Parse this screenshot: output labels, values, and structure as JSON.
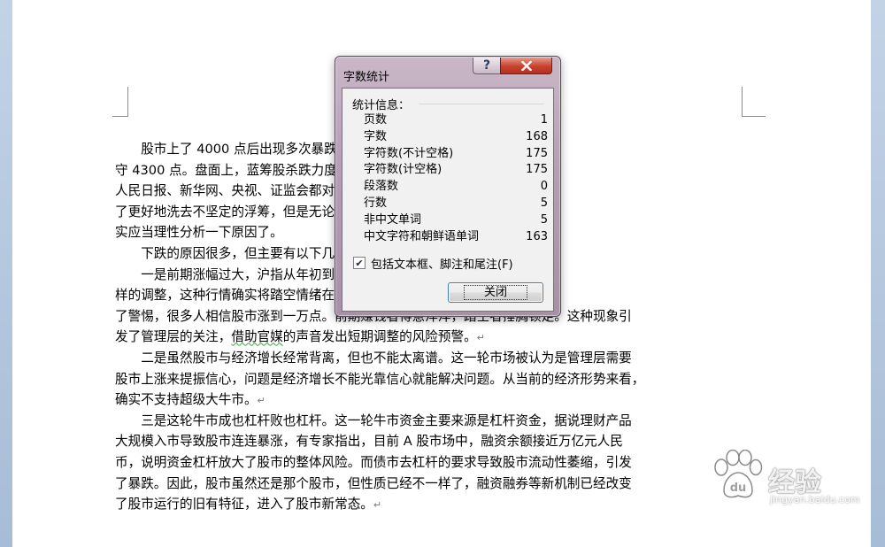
{
  "document": {
    "lines": [
      {
        "indent": true,
        "text": "股市上了 4000 点后出现多次暴跌，据报道称，5 日沪指跌逾 4%，失"
      },
      {
        "indent": false,
        "text": "守 4300 点。盘面上，蓝筹股杀跌力度最大，板块跌幅居前，而就在此前，"
      },
      {
        "indent": false,
        "text": "人民日报、新华网、央视、证监会都对市场暴跌，有的人认为是洗盘，为"
      },
      {
        "indent": false,
        "text": "了更好地洗去不坚定的浮筹，但是无论是洗盘还是见顶，这次大跌确"
      },
      {
        "indent": false,
        "text": "实应当理性分析一下原因了。"
      },
      {
        "indent": true,
        "text": "下跌的原因很多，但主要有以下几点："
      },
      {
        "indent": true,
        "text": "一是前期涨幅过大，沪指从年初到 4500 点左右，几乎没有像"
      },
      {
        "indent": false,
        "text": "样的调整，这种行情确实将踏空情绪在民间传染，人们已经逐渐失去"
      },
      {
        "indent": false,
        "text": "了警惕，很多人相信股市涨到一万点。前期赚钱者得意洋洋，踏空者捶胸顿足。这种现象引"
      },
      {
        "indent": false,
        "pre": "发了管理层的关注，",
        "wavy": "借助官媒",
        "post": "的声音发出短期调整的风险预警。",
        "mark": "↵"
      },
      {
        "indent": true,
        "text": "二是虽然股市与经济增长经常背离，但也不能太离谱。这一轮市场被认为是管理层需要"
      },
      {
        "indent": false,
        "text": "股市上涨来提振信心，问题是经济增长不能光靠信心就能解决问题。从当前的经济形势来看，"
      },
      {
        "indent": false,
        "text": "确实不支持超级大牛市。",
        "mark": "↵"
      },
      {
        "indent": true,
        "text": "三是这轮牛市成也杠杆败也杠杆。这一轮牛市资金主要来源是杠杆资金，据说理财产品"
      },
      {
        "indent": false,
        "text": "大规模入市导致股市连连暴涨，有专家指出，目前 A 股市场中，融资余额接近万亿元人民"
      },
      {
        "indent": false,
        "text": "币，说明资金杠杆放大了股市的整体风险。而债市去杠杆的要求导致股市流动性萎缩，引发"
      },
      {
        "indent": false,
        "text": "了暴跌。因此，股市虽然还是那个股市，但性质已经不一样了，融资融券等新机制已经改变"
      },
      {
        "indent": false,
        "text": "了股市运行的旧有特征，进入了股市新常态。",
        "mark": "↵"
      }
    ]
  },
  "dialog": {
    "title": "字数统计",
    "help_label": "?",
    "close_icon": "close-icon",
    "section_label": "统计信息：",
    "stats": [
      {
        "label": "页数",
        "value": "1"
      },
      {
        "label": "字数",
        "value": "168"
      },
      {
        "label": "字符数(不计空格)",
        "value": "175"
      },
      {
        "label": "字符数(计空格)",
        "value": "175"
      },
      {
        "label": "段落数",
        "value": "0"
      },
      {
        "label": "行数",
        "value": "5"
      },
      {
        "label": "非中文单词",
        "value": "5"
      },
      {
        "label": "中文字符和朝鲜语单词",
        "value": "163"
      }
    ],
    "checkbox_label": "包括文本框、脚注和尾注(F)",
    "checkbox_checked": true,
    "ok_label": "关闭"
  },
  "watermark": {
    "brand": "经验",
    "url": "jingyan.baidu.com"
  }
}
